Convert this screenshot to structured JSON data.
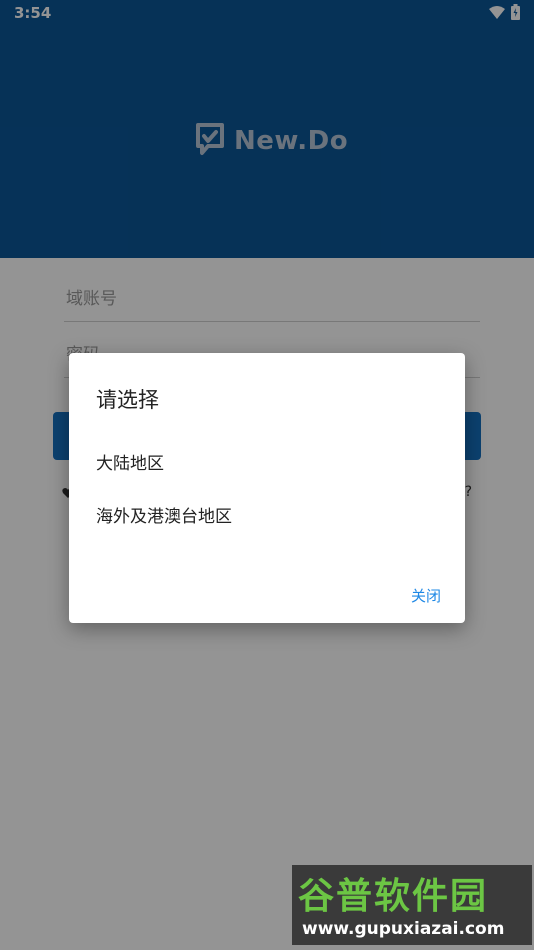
{
  "status_bar": {
    "time": "3:54"
  },
  "header": {
    "logo_text": "New.Do"
  },
  "form": {
    "domain_placeholder": "域账号",
    "password_placeholder": "密码"
  },
  "dialog": {
    "title": "请选择",
    "options": [
      "大陆地区",
      "海外及港澳台地区"
    ],
    "close_label": "关闭"
  },
  "watermark": {
    "title": "谷普软件园",
    "url": "www.gupuxiazai.com"
  },
  "colors": {
    "header_bg": "#0b5697",
    "accent": "#1670bf",
    "link": "#1e88e5"
  }
}
